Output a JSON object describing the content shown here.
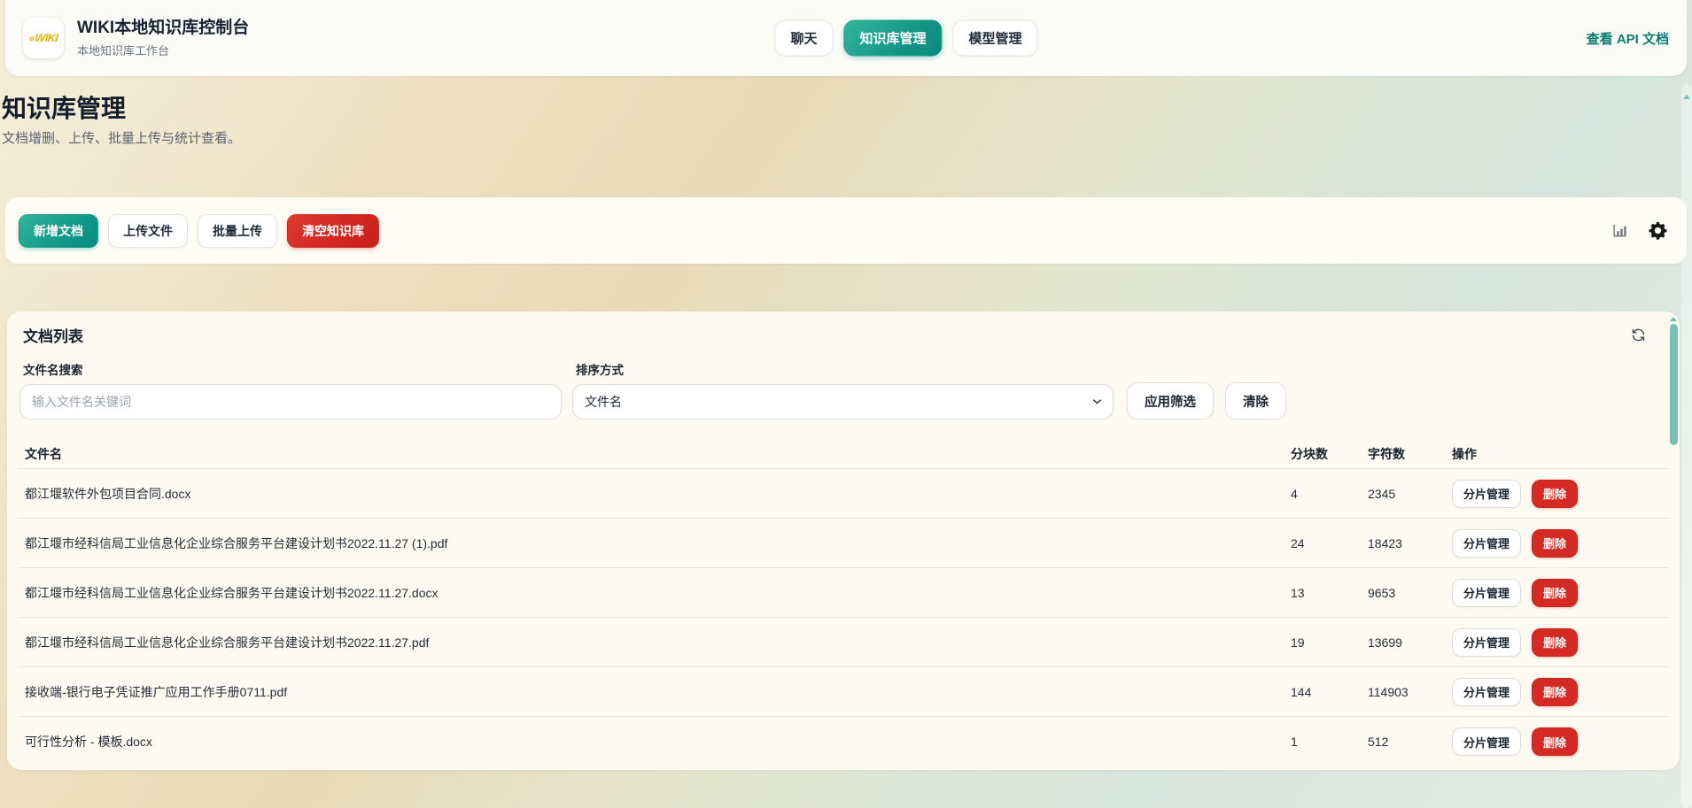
{
  "header": {
    "logo_text": "«WIKI",
    "title": "WIKI本地知识库控制台",
    "subtitle": "本地知识库工作台",
    "nav": [
      {
        "label": "聊天",
        "active": false
      },
      {
        "label": "知识库管理",
        "active": true
      },
      {
        "label": "模型管理",
        "active": false
      }
    ],
    "api_link": "查看 API 文档"
  },
  "hero": {
    "title": "知识库管理",
    "subtitle": "文档增删、上传、批量上传与统计查看。"
  },
  "toolbar": {
    "add_doc": "新增文档",
    "upload_file": "上传文件",
    "batch_upload": "批量上传",
    "clear_kb": "清空知识库",
    "icons": [
      "bar-chart-icon",
      "gear-icon"
    ]
  },
  "document_list": {
    "title": "文档列表",
    "search_label": "文件名搜索",
    "search_placeholder": "输入文件名关键词",
    "search_value": "",
    "sort_label": "排序方式",
    "sort_value": "文件名",
    "apply_filter": "应用筛选",
    "clear_filter": "清除",
    "columns": [
      "文件名",
      "分块数",
      "字符数",
      "操作"
    ],
    "row_actions": {
      "manage": "分片管理",
      "delete": "删除"
    },
    "rows": [
      {
        "name": "都江堰软件外包项目合同.docx",
        "chunks": "4",
        "chars": "2345"
      },
      {
        "name": "都江堰市经科信局工业信息化企业综合服务平台建设计划书2022.11.27 (1).pdf",
        "chunks": "24",
        "chars": "18423"
      },
      {
        "name": "都江堰市经科信局工业信息化企业综合服务平台建设计划书2022.11.27.docx",
        "chunks": "13",
        "chars": "9653"
      },
      {
        "name": "都江堰市经科信局工业信息化企业综合服务平台建设计划书2022.11.27.pdf",
        "chunks": "19",
        "chars": "13699"
      },
      {
        "name": "接收端-银行电子凭证推广应用工作手册0711.pdf",
        "chunks": "144",
        "chars": "114903"
      },
      {
        "name": "可行性分析 - 模板.docx",
        "chunks": "1",
        "chars": "512"
      }
    ]
  },
  "colors": {
    "primary_teal": "#0f9488",
    "danger_red": "#d42a23",
    "link_teal": "#0c7c72",
    "scrollbar_teal": "#76c0b8",
    "page_beige": "#eaddbc",
    "page_sage": "#d6e5dd"
  }
}
